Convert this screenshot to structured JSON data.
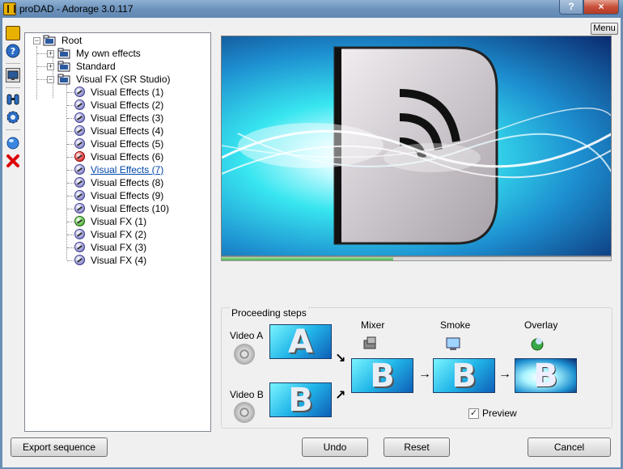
{
  "window": {
    "title": "proDAD - Adorage 3.0.117",
    "help_label": "?",
    "close_label": "×"
  },
  "menu": {
    "label": "Menu"
  },
  "tree": {
    "root": "Root",
    "folders": [
      {
        "label": "My own effects",
        "expander": "+"
      },
      {
        "label": "Standard",
        "expander": "+"
      },
      {
        "label": "Visual FX (SR Studio)",
        "expander": "−"
      }
    ],
    "items": [
      {
        "label": "Visual Effects (1)",
        "icon": "normal"
      },
      {
        "label": "Visual Effects (2)",
        "icon": "normal"
      },
      {
        "label": "Visual Effects (3)",
        "icon": "normal"
      },
      {
        "label": "Visual Effects (4)",
        "icon": "normal"
      },
      {
        "label": "Visual Effects (5)",
        "icon": "normal"
      },
      {
        "label": "Visual Effects (6)",
        "icon": "red"
      },
      {
        "label": "Visual Effects (7)",
        "icon": "normal",
        "selected": true
      },
      {
        "label": "Visual Effects (8)",
        "icon": "normal"
      },
      {
        "label": "Visual Effects (9)",
        "icon": "normal"
      },
      {
        "label": "Visual Effects (10)",
        "icon": "normal"
      },
      {
        "label": "Visual FX (1)",
        "icon": "green"
      },
      {
        "label": "Visual FX (2)",
        "icon": "normal"
      },
      {
        "label": "Visual FX (3)",
        "icon": "normal"
      },
      {
        "label": "Visual FX (4)",
        "icon": "normal"
      }
    ]
  },
  "preview": {
    "progress": 0.44
  },
  "steps": {
    "title": "Proceeding steps",
    "video_a": "Video A",
    "video_b": "Video B",
    "mixer": "Mixer",
    "smoke": "Smoke",
    "overlay": "Overlay",
    "preview_label": "Preview",
    "preview_checked": true
  },
  "buttons": {
    "export": "Export sequence",
    "undo": "Undo",
    "reset": "Reset",
    "cancel": "Cancel"
  }
}
